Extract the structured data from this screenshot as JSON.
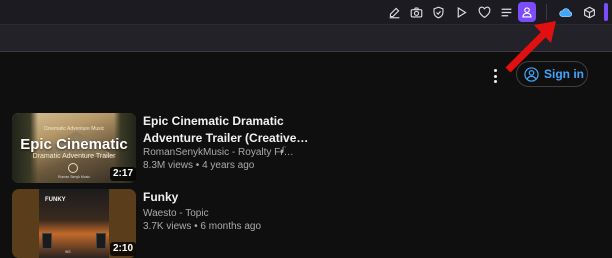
{
  "toolbar": {
    "icons": [
      "edit-icon",
      "camera-icon",
      "shield-icon",
      "play-icon",
      "heart-icon",
      "menu-icon",
      "profile-icon",
      "cloud-icon",
      "cube-icon"
    ],
    "accent_color": "#7b4dff"
  },
  "header": {
    "signin_label": "Sign in",
    "signin_color": "#3ea6ff"
  },
  "videos": [
    {
      "title_line1": "Epic Cinematic Dramatic",
      "title_line2": "Adventure Trailer (Creative…",
      "channel": "RomanSenykMusic - Royalty Fr…",
      "stats": "8.3M views  • 4 years ago",
      "duration": "2:17",
      "thumb_tiny": "Cinematic Adventure Music",
      "thumb_big": "Epic Cinematic",
      "thumb_sub": "Dramatic Adventure Trailer",
      "thumb_credit": "Roman Senyk Music"
    },
    {
      "title_line1": "Funky",
      "channel": "Waesto - Topic",
      "stats": "3.7K views  • 6 months ago",
      "duration": "2:10",
      "thumb_text": "FUNKY",
      "thumb_mark": "WS"
    }
  ],
  "annotation": {
    "arrow_color": "#e01010"
  }
}
